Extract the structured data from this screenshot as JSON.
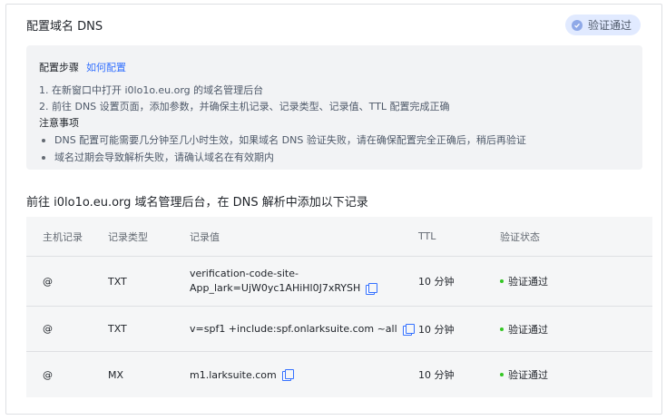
{
  "card": {
    "title": "配置域名 DNS",
    "status_label": "验证通过"
  },
  "steps": {
    "label": "配置步骤",
    "link": "如何配置",
    "items": [
      "1. 在新窗口中打开 i0lo1o.eu.org 的域名管理后台",
      "2. 前往 DNS 设置页面，添加参数，并确保主机记录、记录类型、记录值、TTL 配置完成正确"
    ],
    "notes_label": "注意事项",
    "notes": [
      "DNS 配置可能需要几分钟至几小时生效，如果域名 DNS 验证失败，请在确保配置完全正确后，稍后再验证",
      "域名过期会导致解析失败，请确认域名在有效期内"
    ]
  },
  "section": {
    "title": "前往 i0lo1o.eu.org 域名管理后台，在 DNS 解析中添加以下记录"
  },
  "table": {
    "headers": [
      "主机记录",
      "记录类型",
      "记录值",
      "TTL",
      "验证状态"
    ],
    "rows": [
      {
        "host": "@",
        "type": "TXT",
        "value_line1": "verification-code-site-",
        "value_line2": "App_lark=UjW0yc1AHiHl0J7xRYSH",
        "ttl": "10 分钟",
        "status": "验证通过"
      },
      {
        "host": "@",
        "type": "TXT",
        "value_line1": "v=spf1 +include:spf.onlarksuite.com ~all",
        "value_line2": "",
        "ttl": "10 分钟",
        "status": "验证通过"
      },
      {
        "host": "@",
        "type": "MX",
        "value_line1": "m1.larksuite.com",
        "value_line2": "",
        "ttl": "10 分钟",
        "status": "验证通过"
      }
    ]
  },
  "colors": {
    "accent": "#3370ff",
    "success": "#34c724",
    "tag_bg": "#e1eaff"
  }
}
